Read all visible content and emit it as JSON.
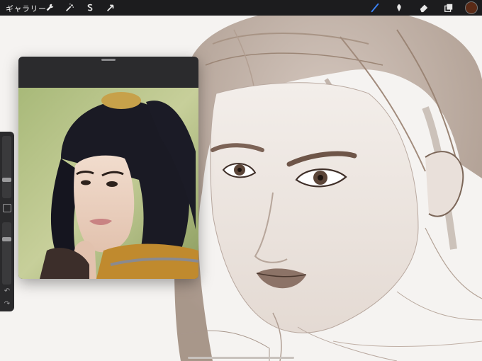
{
  "toolbar": {
    "gallery_label": "ギャラリー",
    "left_tools": [
      {
        "icon": "wrench-icon",
        "name": "actions-button"
      },
      {
        "icon": "magic-wand-icon",
        "name": "adjustments-button"
      },
      {
        "icon": "selection-s-icon",
        "name": "selection-button"
      },
      {
        "icon": "arrow-cursor-icon",
        "name": "transform-button"
      }
    ],
    "right_tools": [
      {
        "icon": "brush-icon",
        "name": "paint-button",
        "active": true
      },
      {
        "icon": "smudge-icon",
        "name": "smudge-button"
      },
      {
        "icon": "eraser-icon",
        "name": "erase-button"
      },
      {
        "icon": "layers-icon",
        "name": "layers-button"
      }
    ],
    "current_color": "#5a2a16",
    "active_accent": "#3b82f6"
  },
  "sidebar": {
    "brush_size_level": 0.28,
    "opacity_level": 0.75,
    "undo_icon": "undo-icon",
    "redo_icon": "redo-icon"
  },
  "reference": {
    "icon": "reference-photo"
  }
}
